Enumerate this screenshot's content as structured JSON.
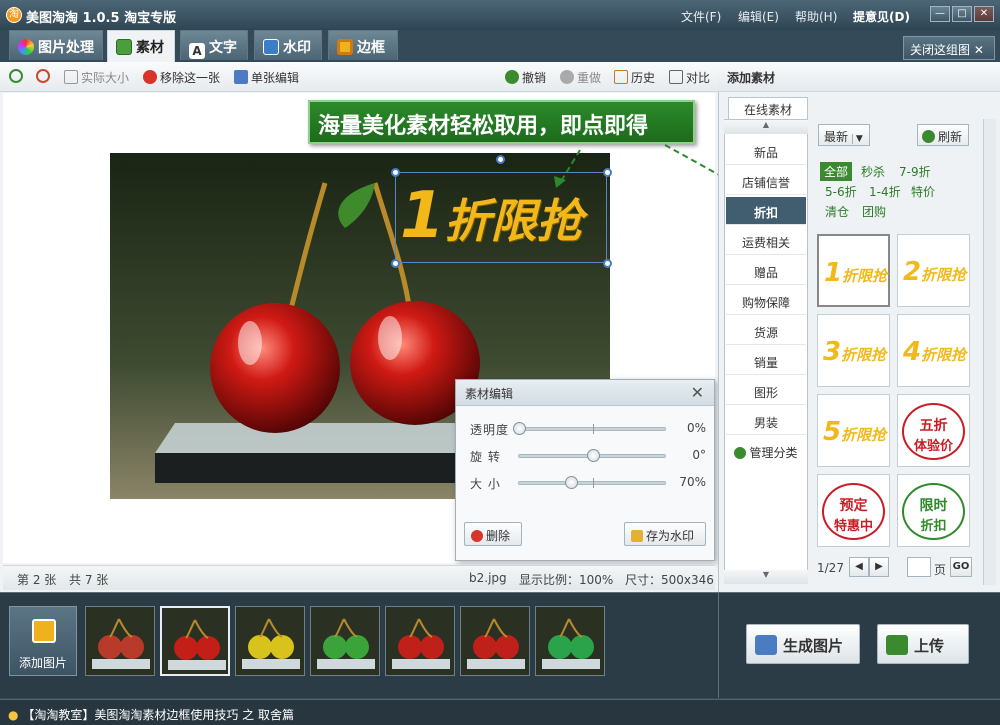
{
  "title": {
    "app_name": "美图淘淘 1.0.5 淘宝专版",
    "logo_char": "淘"
  },
  "menu": [
    "文件(F)",
    "编辑(E)",
    "帮助(H)",
    "提意见(D)"
  ],
  "window_buttons": {
    "minimize": "—",
    "maximize": "□",
    "close": "✕"
  },
  "tabs": [
    "图片处理",
    "素材",
    "文字",
    "水印",
    "边框"
  ],
  "close_group": "关闭这组图",
  "toolbar": {
    "actual_size": "实际大小",
    "remove": "移除这一张",
    "single_edit": "单张编辑",
    "undo": "撤销",
    "redo": "重做",
    "history": "历史",
    "compare": "对比"
  },
  "banner": "海量美化素材轻松取用，即点即得",
  "sticker": {
    "num": "1",
    "text": "折限抢"
  },
  "panel": {
    "title": "素材编辑",
    "close": "✕",
    "sliders": [
      {
        "label": "透明度",
        "value": "0%",
        "pos": 0
      },
      {
        "label": "旋  转",
        "value": "0°",
        "pos": 0.5
      },
      {
        "label": "大  小",
        "value": "70%",
        "pos": 0.35
      }
    ],
    "delete_btn": "删除",
    "save_watermark_btn": "存为水印"
  },
  "status": {
    "page": "第 2 张",
    "total": "共 7 张",
    "filename": "b2.jpg",
    "zoom": "显示比例：100%",
    "size": "尺寸：500x346"
  },
  "right": {
    "title": "添加素材",
    "online_tab": "在线素材",
    "categories": [
      "新品",
      "店铺信誉",
      "折扣",
      "运费相关",
      "赠品",
      "购物保障",
      "货源",
      "销量",
      "图形",
      "男装"
    ],
    "active_category": "折扣",
    "manage": "管理分类",
    "sort": "最新",
    "refresh": "刷新",
    "filters": [
      "全部",
      "秒杀",
      "7-9折",
      "5-6折",
      "1-4折",
      "特价",
      "清仓",
      "团购"
    ],
    "thumbs": [
      {
        "num": "1",
        "text": "折限抢",
        "color": "#f2b81a"
      },
      {
        "num": "2",
        "text": "折限抢",
        "color": "#f2b81a"
      },
      {
        "num": "3",
        "text": "折限抢",
        "color": "#f2b81a"
      },
      {
        "num": "4",
        "text": "折限抢",
        "color": "#f2b81a"
      },
      {
        "num": "5",
        "text": "折限抢",
        "color": "#f2b81a"
      },
      {
        "num": "五折",
        "text": "体验价",
        "color": "#c81d25"
      },
      {
        "num": "预定",
        "text": "特惠中",
        "color": "#c81d25"
      },
      {
        "num": "限时",
        "text": "折扣",
        "color": "#2e8a2b"
      }
    ],
    "pager": {
      "current": "1/27",
      "page_label": "页",
      "go": "GO"
    }
  },
  "filmstrip": {
    "add": "添加图片",
    "count": 7,
    "selected": 1
  },
  "actions": {
    "generate": "生成图片",
    "upload": "上传"
  },
  "bottom": "【淘淘教室】美图淘淘素材边框使用技巧 之 取舍篇",
  "colors": {
    "accent_green": "#2c8a2b",
    "sticker_gold": "#f2b81a",
    "title_bar": "#3e5767"
  }
}
